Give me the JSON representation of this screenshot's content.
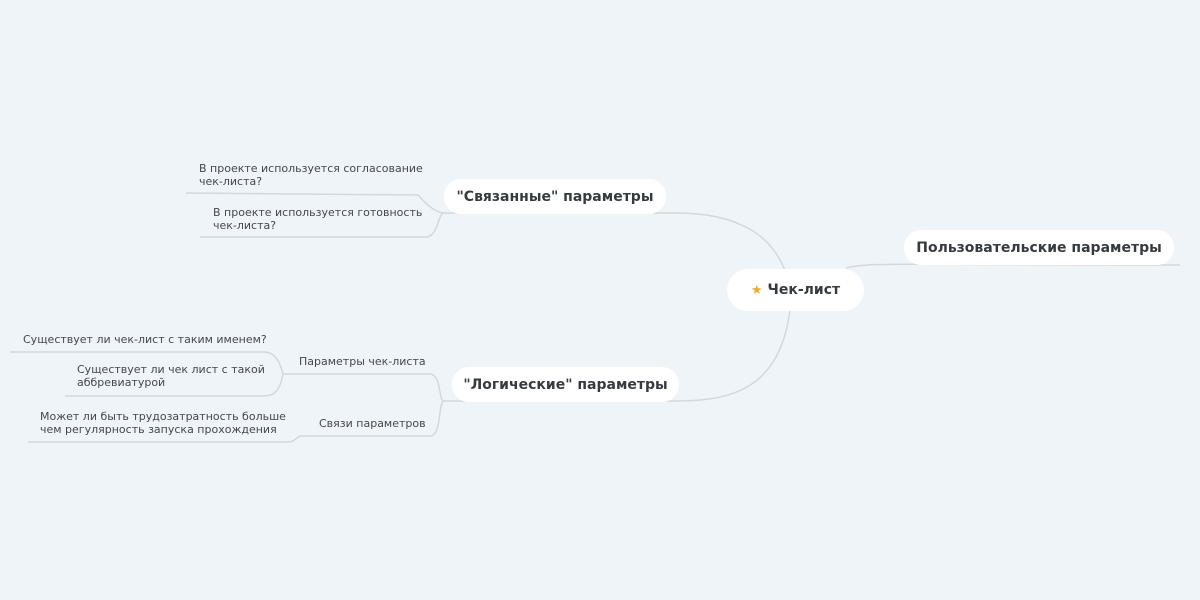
{
  "root": {
    "label": "Чек-лист",
    "icon": "star-icon",
    "icon_color": "#f0a830"
  },
  "right_topic": {
    "label": "Пользовательские параметры"
  },
  "linked_topic": {
    "label": "\"Связанные\" параметры",
    "items": [
      "В проекте используется согласование чек-листа?",
      "В проекте используется готовность чек-листа?"
    ]
  },
  "logical_topic": {
    "label": "\"Логические\" параметры",
    "groups": [
      {
        "label": "Параметры чек-листа",
        "items": [
          "Существует ли чек-лист с таким именем?",
          "Существует ли чек лист с такой аббревиатурой"
        ]
      },
      {
        "label": "Связи параметров",
        "items": [
          "Может ли быть трудозатратность больше чем регулярность  запуска прохождения"
        ]
      }
    ]
  },
  "colors": {
    "background": "#eff4f8",
    "node_fill": "#ffffff",
    "connector": "#d3d8dd"
  }
}
